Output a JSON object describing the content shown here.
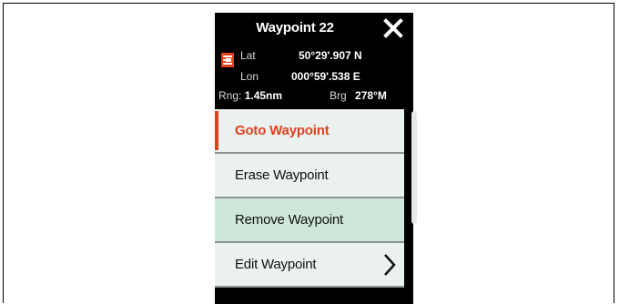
{
  "header": {
    "title": "Waypoint 22",
    "close_icon": "close-icon"
  },
  "position": {
    "lat_label": "Lat",
    "lat_value": "50°29'.907 N",
    "lon_label": "Lon",
    "lon_value": "000°59'.538 E",
    "rng_label": "Rng:",
    "rng_value": "1.45nm",
    "brg_label": "Brg",
    "brg_value": "278°M",
    "waypoint_icon": "waypoint-flag-icon"
  },
  "menu": {
    "items": [
      {
        "label": "Goto Waypoint",
        "state": "active"
      },
      {
        "label": "Erase Waypoint",
        "state": "normal"
      },
      {
        "label": "Remove Waypoint",
        "state": "highlighted"
      },
      {
        "label": "Edit Waypoint",
        "state": "normal",
        "submenu_icon": "chevron-right-icon"
      }
    ]
  },
  "colors": {
    "accent": "#e2401d",
    "menu_bg": "#eaf1ef",
    "menu_highlight": "#cfe6da",
    "panel_bg": "#000000"
  }
}
